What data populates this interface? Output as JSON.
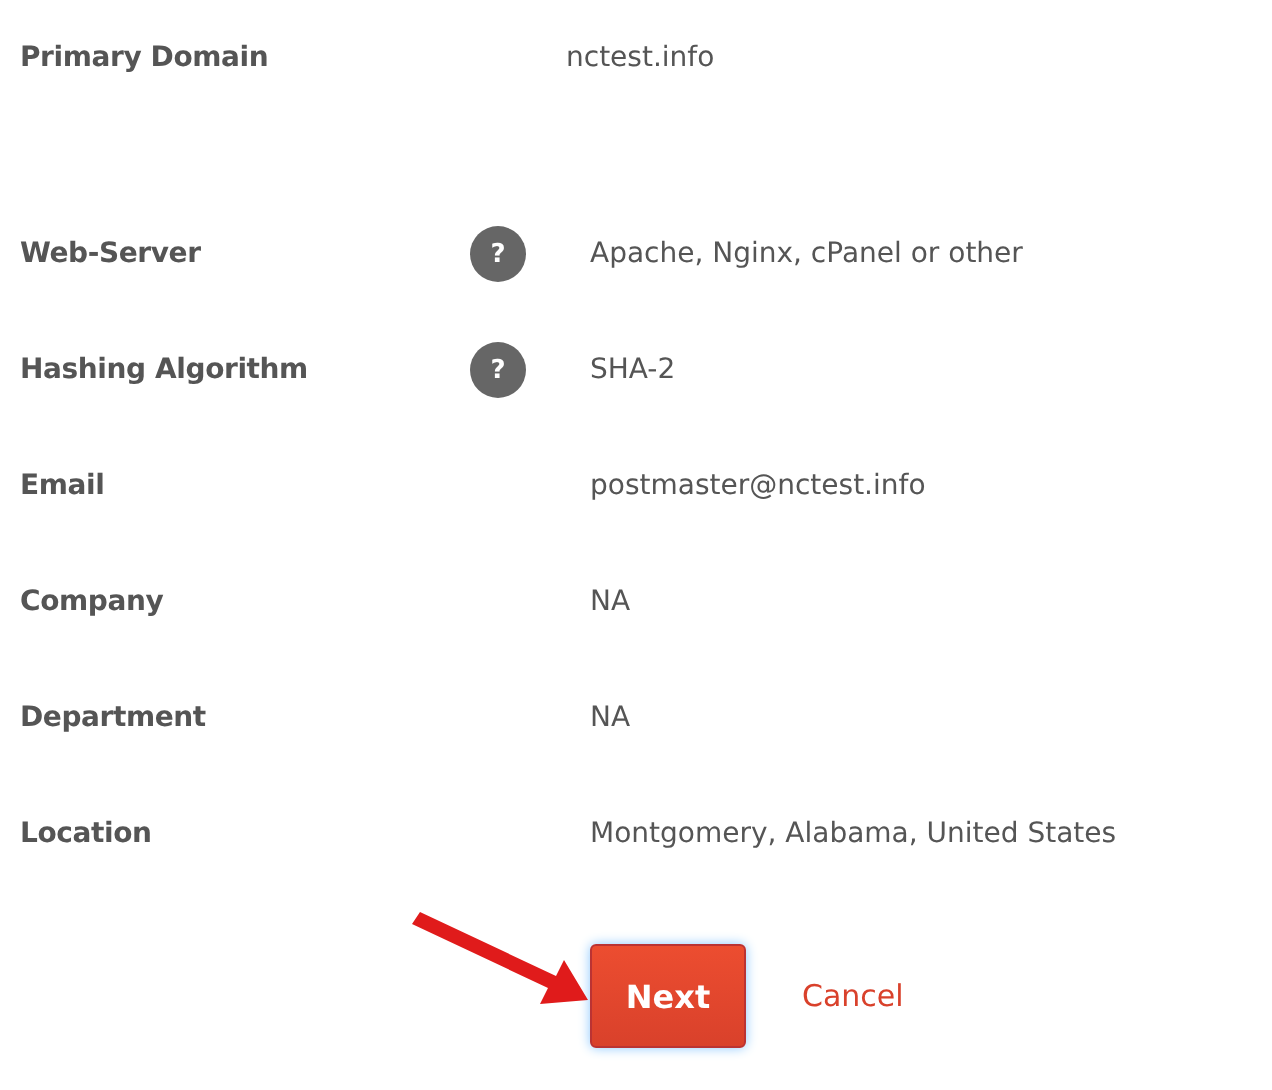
{
  "fields": [
    {
      "label": "Primary Domain",
      "value": "nctest.info",
      "help": false,
      "kind": "primary"
    },
    {
      "label": "Web-Server",
      "value": "Apache, Nginx, cPanel or other",
      "help": true,
      "kind": "plain"
    },
    {
      "label": "Hashing Algorithm",
      "value": "SHA-2",
      "help": true,
      "kind": "plain"
    },
    {
      "label": "Email",
      "value": "postmaster@nctest.info",
      "help": false,
      "kind": "plain"
    },
    {
      "label": "Company",
      "value": "NA",
      "help": false,
      "kind": "plain"
    },
    {
      "label": "Department",
      "value": "NA",
      "help": false,
      "kind": "plain"
    },
    {
      "label": "Location",
      "value": "Montgomery, Alabama, United States",
      "help": false,
      "kind": "plain"
    }
  ],
  "help_icon": "?",
  "buttons": {
    "next": "Next",
    "cancel": "Cancel"
  }
}
